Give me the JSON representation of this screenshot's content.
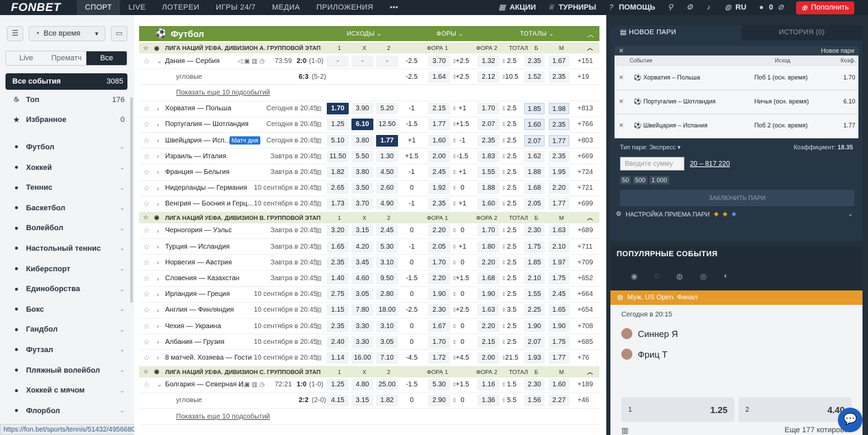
{
  "header": {
    "logo": "FONBET",
    "nav": [
      "СПОРТ",
      "LIVE",
      "ЛОТЕРЕИ",
      "ИГРЫ 24/7",
      "МЕДИА",
      "ПРИЛОЖЕНИЯ",
      "•••"
    ],
    "promo": "АКЦИИ",
    "tourn": "ТУРНИРЫ",
    "help": "ПОМОЩЬ",
    "lang": "RU",
    "balance": "0",
    "deposit": "Пополнить"
  },
  "left": {
    "time_filter": "Все время",
    "seg": [
      "Live",
      "Прематч",
      "Все"
    ],
    "all": {
      "label": "Все события",
      "count": "3085"
    },
    "top": {
      "label": "Топ",
      "count": "176"
    },
    "fav": {
      "label": "Избранное",
      "count": "0"
    },
    "sports": [
      "Футбол",
      "Хоккей",
      "Теннис",
      "Баскетбол",
      "Волейбол",
      "Настольный теннис",
      "Киберспорт",
      "Единоборства",
      "Бокс",
      "Гандбол",
      "Футзал",
      "Пляжный волейбол",
      "Хоккей с мячом",
      "Флорбол"
    ],
    "status_url": "https://fon.bet/sports/tennis/51432/49566807/?prevSource=top"
  },
  "main": {
    "sport": "Футбол",
    "h_out": "ИСХОДЫ",
    "h_fora": "ФОРЫ",
    "h_total": "ТОТАЛЫ",
    "cols": [
      "1",
      "X",
      "2",
      "ФОРА 1",
      "ФОРА 2",
      "ТОТАЛ",
      "Б",
      "М"
    ],
    "leagues": [
      "ЛИГА НАЦИЙ УЕФА. ДИВИЗИОН А. ГРУППОВОЙ ЭТАП",
      "ЛИГА НАЦИЙ УЕФА. ДИВИЗИОН B. ГРУППОВОЙ ЭТАП",
      "ЛИГА НАЦИЙ УЕФА. ДИВИЗИОН С. ГРУППОВОЙ ЭТАП"
    ],
    "rows": [
      {
        "n": "Дания — Сербия",
        "t": "73:59",
        "s": "2:0",
        "sp": "(1-0)",
        "o": [
          "-",
          "-",
          "-",
          "-2.5",
          "3.70",
          "+2.5",
          "1.32",
          "2.5",
          "2.35",
          "1.67"
        ],
        "p": "+151",
        "live": true
      },
      {
        "n": "угловые",
        "sc": "6:3",
        "scp": "(5-2)",
        "o": [
          "",
          "",
          "",
          "-2.5",
          "1.64",
          "+2.5",
          "2.12",
          "10.5",
          "1.52",
          "2.35"
        ],
        "p": "+19",
        "sub": true
      },
      {
        "link": "Показать еще 10 подсобытий"
      },
      {
        "n": "Хорватия — Польша",
        "t": "Сегодня в 20:45",
        "o": [
          "1.70",
          "3.90",
          "5.20",
          "-1",
          "2.15",
          "+1",
          "1.70",
          "2.5",
          "1.85",
          "1.98"
        ],
        "p": "+813",
        "dk": 0,
        "bl": [
          8,
          9
        ]
      },
      {
        "n": "Португалия — Шотландия",
        "t": "Сегодня в 20:45",
        "o": [
          "1.25",
          "6.10",
          "12.50",
          "-1.5",
          "1.77",
          "+1.5",
          "2.07",
          "2.5",
          "1.60",
          "2.35"
        ],
        "p": "+766",
        "dk": 1,
        "bl": [
          8,
          9
        ]
      },
      {
        "n": "Швейцария — Исп...",
        "badge": "Матч дня",
        "t": "Сегодня в 20:45",
        "o": [
          "5.10",
          "3.80",
          "1.77",
          "+1",
          "1.60",
          "-1",
          "2.35",
          "2.5",
          "2.07",
          "1.77"
        ],
        "p": "+803",
        "dk": 2,
        "bl": [
          8,
          9
        ]
      },
      {
        "n": "Израиль — Италия",
        "t": "Завтра в 20:45",
        "o": [
          "11.50",
          "5.50",
          "1.30",
          "+1.5",
          "2.00",
          "-1.5",
          "1.83",
          "2.5",
          "1.62",
          "2.35"
        ],
        "p": "+669"
      },
      {
        "n": "Франция — Бельгия",
        "t": "Завтра в 20:45",
        "o": [
          "1.82",
          "3.80",
          "4.50",
          "-1",
          "2.45",
          "+1",
          "1.55",
          "2.5",
          "1.88",
          "1.95"
        ],
        "p": "+724"
      },
      {
        "n": "Нидерланды — Германия",
        "t": "10 сентября в 20:45",
        "o": [
          "2.65",
          "3.50",
          "2.60",
          "0",
          "1.92",
          "0",
          "1.88",
          "2.5",
          "1.68",
          "2.20"
        ],
        "p": "+721"
      },
      {
        "n": "Венгрия — Босния и Герц...",
        "t": "10 сентября в 20:45",
        "o": [
          "1.73",
          "3.70",
          "4.90",
          "-1",
          "2.35",
          "+1",
          "1.60",
          "2.5",
          "2.05",
          "1.77"
        ],
        "p": "+699"
      },
      {
        "league": 1
      },
      {
        "n": "Черногория — Уэльс",
        "t": "Завтра в 20:45",
        "o": [
          "3.20",
          "3.15",
          "2.45",
          "0",
          "2.20",
          "0",
          "1.70",
          "2.5",
          "2.30",
          "1.63"
        ],
        "p": "+689"
      },
      {
        "n": "Турция — Исландия",
        "t": "Завтра в 20:45",
        "o": [
          "1.65",
          "4.20",
          "5.30",
          "-1",
          "2.05",
          "+1",
          "1.80",
          "2.5",
          "1.75",
          "2.10"
        ],
        "p": "+711"
      },
      {
        "n": "Норвегия — Австрия",
        "t": "Завтра в 20:45",
        "o": [
          "2.35",
          "3.45",
          "3.10",
          "0",
          "1.70",
          "0",
          "2.20",
          "2.5",
          "1.85",
          "1.97"
        ],
        "p": "+709"
      },
      {
        "n": "Словения — Казахстан",
        "t": "Завтра в 20:45",
        "o": [
          "1.40",
          "4.60",
          "9.50",
          "-1.5",
          "2.20",
          "+1.5",
          "1.68",
          "2.5",
          "2.10",
          "1.75"
        ],
        "p": "+652"
      },
      {
        "n": "Ирландия — Греция",
        "t": "10 сентября в 20:45",
        "o": [
          "2.75",
          "3.05",
          "2.80",
          "0",
          "1.90",
          "0",
          "1.90",
          "2.5",
          "1.55",
          "2.45"
        ],
        "p": "+664"
      },
      {
        "n": "Англия — Финляндия",
        "t": "10 сентября в 20:45",
        "o": [
          "1.15",
          "7.80",
          "18.00",
          "-2.5",
          "2.30",
          "+2.5",
          "1.63",
          "3.5",
          "2.25",
          "1.65"
        ],
        "p": "+654"
      },
      {
        "n": "Чехия — Украина",
        "t": "10 сентября в 20:45",
        "o": [
          "2.35",
          "3.30",
          "3.10",
          "0",
          "1.67",
          "0",
          "2.20",
          "2.5",
          "1.90",
          "1.90"
        ],
        "p": "+708"
      },
      {
        "n": "Албания — Грузия",
        "t": "10 сентября в 20:45",
        "o": [
          "2.40",
          "3.30",
          "3.05",
          "0",
          "1.70",
          "0",
          "2.15",
          "2.5",
          "2.07",
          "1.75"
        ],
        "p": "+685"
      },
      {
        "n": "8 матчей. Хозяева — Гости",
        "t": "10 сентября в 20:45",
        "o": [
          "1.14",
          "16.00",
          "7.10",
          "-4.5",
          "1.72",
          "+4.5",
          "2.00",
          "21.5",
          "1.93",
          "1.77"
        ],
        "p": "+76"
      },
      {
        "league": 2
      },
      {
        "n": "Болгария — Северная И...",
        "t": "72:21",
        "s": "1:0",
        "sp": "(1-0)",
        "o": [
          "1.25",
          "4.80",
          "25.00",
          "-1.5",
          "5.30",
          "+1.5",
          "1.16",
          "1.5",
          "2.30",
          "1.60"
        ],
        "p": "+189",
        "live": true
      },
      {
        "n": "угловые",
        "sc": "2:2",
        "scp": "(2-0)",
        "o": [
          "4.15",
          "3.15",
          "1.82",
          "0",
          "2.90",
          "0",
          "1.36",
          "5.5",
          "1.56",
          "2.27"
        ],
        "p": "+46",
        "sub": true
      },
      {
        "link": "Показать еще 10 подсобытий"
      }
    ]
  },
  "betslip": {
    "tab1": "НОВОЕ ПАРИ",
    "tab2": "ИСТОРИЯ (0)",
    "bar": "Новое пари",
    "h": [
      "Событие",
      "Исход",
      "Коэф."
    ],
    "picks": [
      {
        "e": "Хорватия – Польша",
        "o": "Поб 1 (осн. время)",
        "k": "1.70"
      },
      {
        "e": "Португалия – Шотландия",
        "o": "Ничья (осн. время)",
        "k": "6.10"
      },
      {
        "e": "Швейцария – Испания",
        "o": "Поб 2 (осн. время)",
        "k": "1.77"
      }
    ],
    "type_label": "Тип пари:",
    "type": "Экспресс",
    "coef_label": "Коэффициент:",
    "coef": "18.35",
    "amount_ph": "Введите сумму",
    "range": "20 – 817 220",
    "chips": [
      "50",
      "500",
      "1 000"
    ],
    "place": "ЗАКЛЮЧИТЬ ПАРИ",
    "settings": "НАСТРОЙКА ПРИЕМА ПАРИ"
  },
  "popular": {
    "title": "ПОПУЛЯРНЫЕ СОБЫТИЯ",
    "event": "Муж. US Open. Финал",
    "time": "Сегодня в 20:15",
    "p1": "Синнер Я",
    "p2": "Фриц Т",
    "o1l": "1",
    "o1": "1.25",
    "o2l": "2",
    "o2": "4.40",
    "more": "Еще 177 котировок"
  }
}
